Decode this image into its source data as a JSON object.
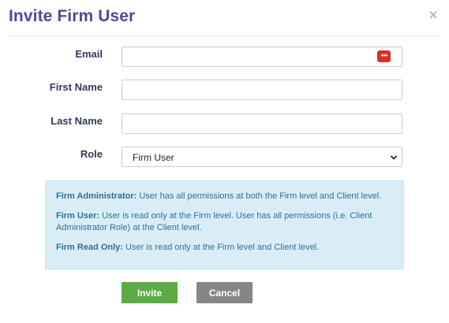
{
  "modal": {
    "title": "Invite Firm User",
    "close_symbol": "×"
  },
  "form": {
    "email": {
      "label": "Email",
      "value": "",
      "placeholder": ""
    },
    "first_name": {
      "label": "First Name",
      "value": "",
      "placeholder": ""
    },
    "last_name": {
      "label": "Last Name",
      "value": "",
      "placeholder": ""
    },
    "role": {
      "label": "Role",
      "selected": "Firm User"
    },
    "password_manager_icon_text": "•••"
  },
  "info": {
    "firm_admin": {
      "term": "Firm Administrator:",
      "text": " User has all permissions at both the Firm level and Client level."
    },
    "firm_user": {
      "term": "Firm User:",
      "text": " User is read only at the Firm level. User has all permissions (i.e. Client Administrator Role) at the Client level."
    },
    "firm_read_only": {
      "term": "Firm Read Only:",
      "text": " User is read only at the Firm level and Client level."
    }
  },
  "buttons": {
    "invite": "Invite",
    "cancel": "Cancel"
  },
  "colors": {
    "title": "#4f4a9a",
    "label": "#333a57",
    "info_bg": "#d9edf7",
    "info_text": "#31708f",
    "invite_bg": "#5cab45",
    "cancel_bg": "#868686",
    "password_icon_bg": "#d9302b"
  }
}
